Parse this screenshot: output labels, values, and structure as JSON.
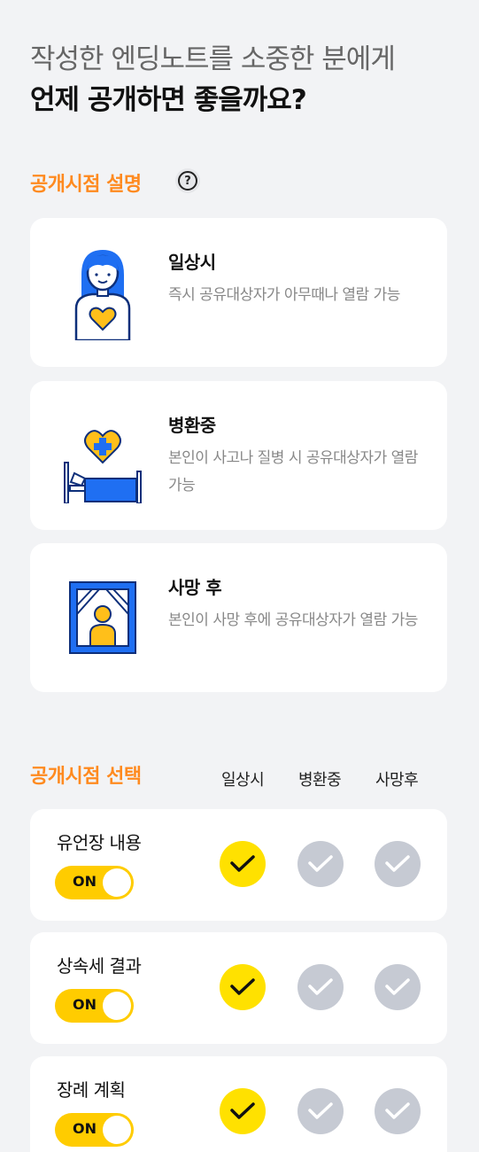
{
  "header": {
    "line1": "작성한 엔딩노트를 소중한 분에게",
    "line2": "언제 공개하면 좋을까요?"
  },
  "explain": {
    "title": "공개시점 설명",
    "help_icon": "?",
    "items": [
      {
        "title": "일상시",
        "text": "즉시 공유대상자가 아무때나 열람 가능",
        "icon": "person-heart-icon"
      },
      {
        "title": "병환중",
        "text": "본인이 사고나 질병 시 공유대상자가 열람 가능",
        "icon": "hospital-bed-icon"
      },
      {
        "title": "사망 후",
        "text": "본인이 사망 후에 공유대상자가 열람 가능",
        "icon": "memorial-frame-icon"
      }
    ]
  },
  "select": {
    "title": "공개시점 선택",
    "columns": [
      "일상시",
      "병환중",
      "사망후"
    ],
    "rows": [
      {
        "label": "유언장 내용",
        "toggle": "ON",
        "checks": [
          true,
          false,
          false
        ]
      },
      {
        "label": "상속세 결과",
        "toggle": "ON",
        "checks": [
          true,
          false,
          false
        ]
      },
      {
        "label": "장례 계획",
        "toggle": "ON",
        "checks": [
          true,
          false,
          false
        ]
      }
    ]
  },
  "colors": {
    "accent": "#ff8a1f",
    "toggle_on": "#ffcc00",
    "check_on": "#ffe100",
    "check_off": "#c6cad3",
    "illustration_blue": "#1f6ff2"
  }
}
